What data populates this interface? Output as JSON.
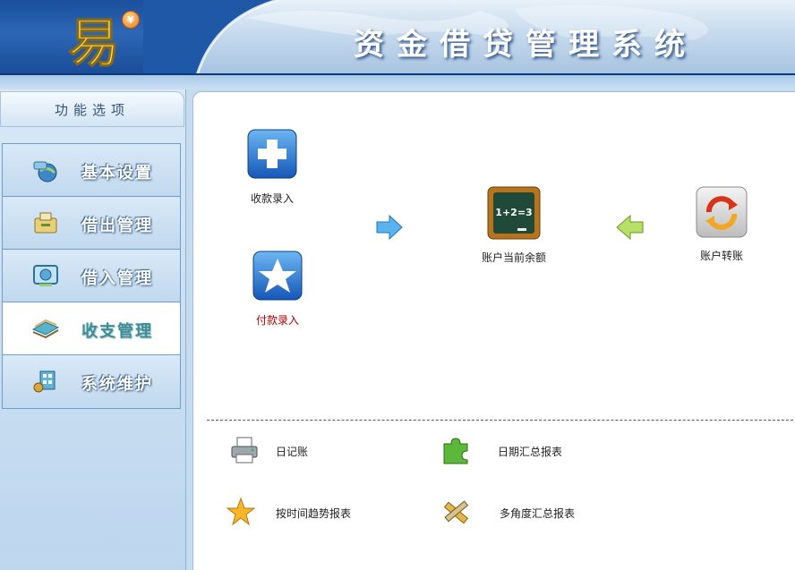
{
  "header": {
    "logo_glyph": "易",
    "coin_symbol": "¥",
    "title": "资金借贷管理系统"
  },
  "sidebar": {
    "title": "功能选项",
    "items": [
      {
        "label": "基本设置",
        "icon": "settings-globe-icon",
        "active": false
      },
      {
        "label": "借出管理",
        "icon": "box-out-icon",
        "active": false
      },
      {
        "label": "借入管理",
        "icon": "monitor-in-icon",
        "active": false
      },
      {
        "label": "收支管理",
        "icon": "books-icon",
        "active": true
      },
      {
        "label": "系统维护",
        "icon": "maintenance-icon",
        "active": false
      }
    ]
  },
  "main": {
    "tiles": {
      "receipt": "收款录入",
      "payment": "付款录入",
      "balance": "账户当前余额",
      "balance_board_text": "1+2=3",
      "transfer": "账户转账"
    },
    "reports": {
      "daily": "日记账",
      "date_summary": "日期汇总报表",
      "trend": "按时间趋势报表",
      "multi_angle": "多角度汇总报表"
    }
  },
  "colors": {
    "header_blue": "#1f58a6",
    "active_menu_text": "#3e8e9a",
    "payment_label": "#b00000"
  }
}
